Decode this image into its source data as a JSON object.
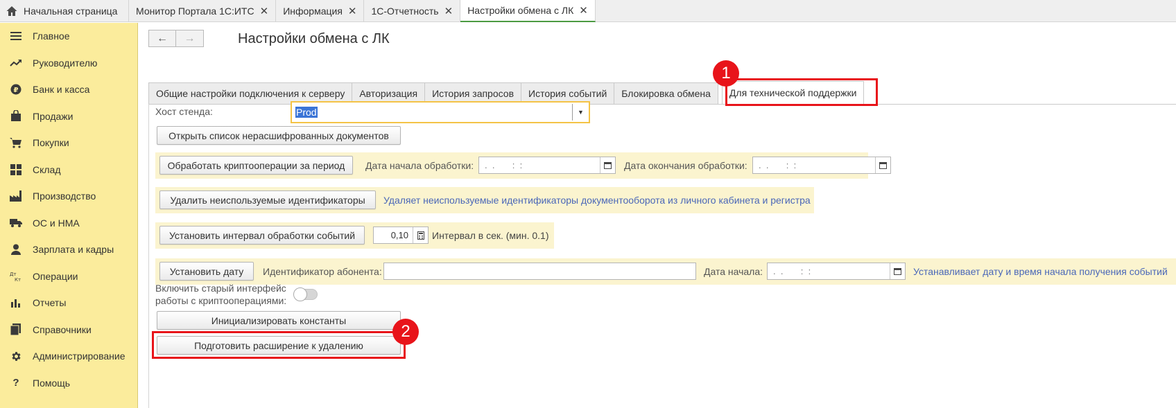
{
  "topbar": {
    "home_label": "Начальная страница",
    "tabs": [
      {
        "label": "Монитор Портала 1С:ИТС",
        "close": "✕"
      },
      {
        "label": "Информация",
        "close": "✕"
      },
      {
        "label": "1С-Отчетность",
        "close": "✕"
      },
      {
        "label": "Настройки обмена с ЛК",
        "close": "✕"
      }
    ]
  },
  "sidebar": {
    "items": [
      {
        "label": "Главное",
        "icon": "menu-icon"
      },
      {
        "label": "Руководителю",
        "icon": "trend-icon"
      },
      {
        "label": "Банк и касса",
        "icon": "ruble-icon"
      },
      {
        "label": "Продажи",
        "icon": "bag-icon"
      },
      {
        "label": "Покупки",
        "icon": "cart-icon"
      },
      {
        "label": "Склад",
        "icon": "warehouse-icon"
      },
      {
        "label": "Производство",
        "icon": "factory-icon"
      },
      {
        "label": "ОС и НМА",
        "icon": "truck-icon"
      },
      {
        "label": "Зарплата и кадры",
        "icon": "person-icon"
      },
      {
        "label": "Операции",
        "icon": "dt-kt-icon"
      },
      {
        "label": "Отчеты",
        "icon": "bar-chart-icon"
      },
      {
        "label": "Справочники",
        "icon": "books-icon"
      },
      {
        "label": "Администрирование",
        "icon": "gear-icon"
      },
      {
        "label": "Помощь",
        "icon": "question-icon"
      }
    ]
  },
  "nav": {
    "back": "←",
    "forward": "→"
  },
  "page_title": "Настройки обмена с ЛК",
  "form_tabs": [
    "Общие настройки подключения к серверу",
    "Авторизация",
    "История запросов",
    "История событий",
    "Блокировка обмена",
    "Для технической поддержки"
  ],
  "form": {
    "host_label": "Хост стенда:",
    "host_value": "Prod",
    "open_list_button": "Открыть список нерасшифрованных документов",
    "process_button": "Обработать криптооперации за период",
    "start_date_label": "Дата начала обработки:",
    "start_date_value": ".  .       :  :",
    "end_date_label": "Дата окончания обработки:",
    "end_date_value": ".  .       :  :",
    "delete_ids_button": "Удалить неиспользуемые идентификаторы",
    "delete_ids_hint": "Удаляет неиспользуемые идентификаторы документооборота из личного кабинета и регистра",
    "interval_button": "Установить интервал обработки событий",
    "interval_value": "0,10",
    "interval_hint": "Интервал в сек. (мин. 0.1)",
    "set_date_button": "Установить дату",
    "subscriber_label": "Идентификатор абонента:",
    "subscriber_value": "",
    "date_start_label": "Дата начала:",
    "date_start_value": ".  .       :  :",
    "date_start_hint": "Устанавливает дату и время начала получения событий",
    "old_interface_label_1": "Включить старый интерфейс",
    "old_interface_label_2": "работы с криптооперациями:",
    "old_interface_enabled": false,
    "init_constants_button": "Инициализировать константы",
    "prepare_extension_button": "Подготовить расширение к удалению"
  },
  "annotations": {
    "badge_1": "1",
    "badge_2": "2"
  },
  "colors": {
    "sidebar_bg": "#fbec9c",
    "callout": "#e8141a",
    "active_tab_underline": "#4c9a42",
    "hint_text": "#4a67b8",
    "host_focus": "#f4c346"
  }
}
